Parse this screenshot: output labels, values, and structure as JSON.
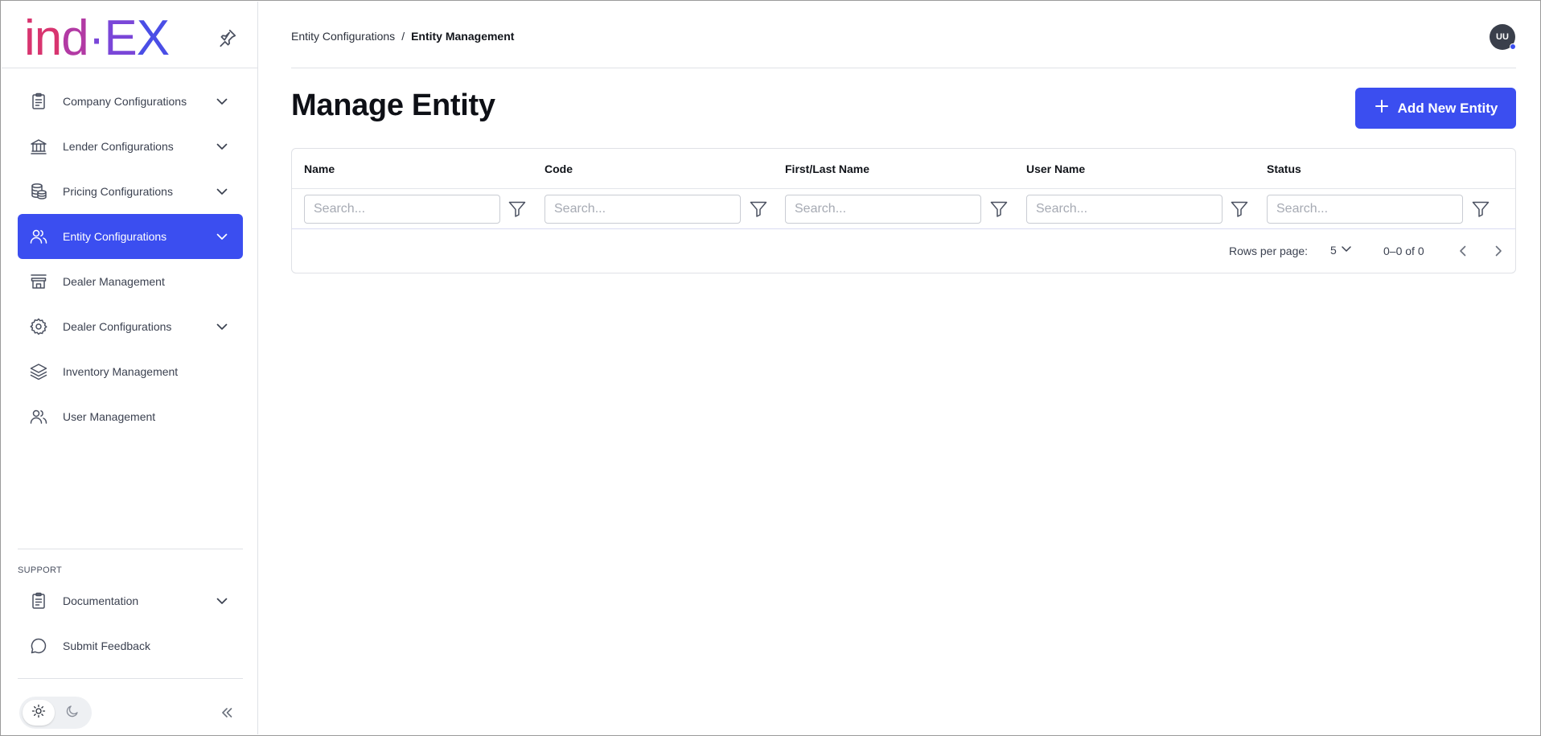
{
  "logo": {
    "part1": "in",
    "part2": "d",
    "part3": "·E",
    "part4": "X"
  },
  "sidebar": {
    "items": [
      {
        "label": "Company Configurations",
        "icon": "clipboard-icon",
        "expandable": true
      },
      {
        "label": "Lender Configurations",
        "icon": "bank-icon",
        "expandable": true
      },
      {
        "label": "Pricing Configurations",
        "icon": "coins-icon",
        "expandable": true
      },
      {
        "label": "Entity Configurations",
        "icon": "users-icon",
        "expandable": true,
        "active": true
      },
      {
        "label": "Dealer Management",
        "icon": "store-icon",
        "expandable": false
      },
      {
        "label": "Dealer Configurations",
        "icon": "gear-icon",
        "expandable": true
      },
      {
        "label": "Inventory Management",
        "icon": "layers-icon",
        "expandable": false
      },
      {
        "label": "User Management",
        "icon": "users-icon",
        "expandable": false
      }
    ],
    "support_label": "SUPPORT",
    "support_items": [
      {
        "label": "Documentation",
        "icon": "clipboard-icon",
        "expandable": true
      },
      {
        "label": "Submit Feedback",
        "icon": "chat-bubble-icon",
        "expandable": false
      }
    ],
    "theme": {
      "selected": "light"
    }
  },
  "breadcrumb": {
    "parent": "Entity Configurations",
    "separator": "/",
    "current": "Entity Management"
  },
  "user": {
    "initials": "UU"
  },
  "page": {
    "title": "Manage Entity",
    "add_button": "Add New Entity"
  },
  "table": {
    "columns": [
      "Name",
      "Code",
      "First/Last Name",
      "User Name",
      "Status"
    ],
    "search_placeholder": "Search...",
    "rows": [],
    "footer": {
      "rows_per_page_label": "Rows per page:",
      "rows_per_page": "5",
      "range": "0–0 of 0"
    }
  },
  "colors": {
    "accent": "#3b4ef0",
    "border": "#dfe1e6",
    "text": "#1f2430"
  }
}
